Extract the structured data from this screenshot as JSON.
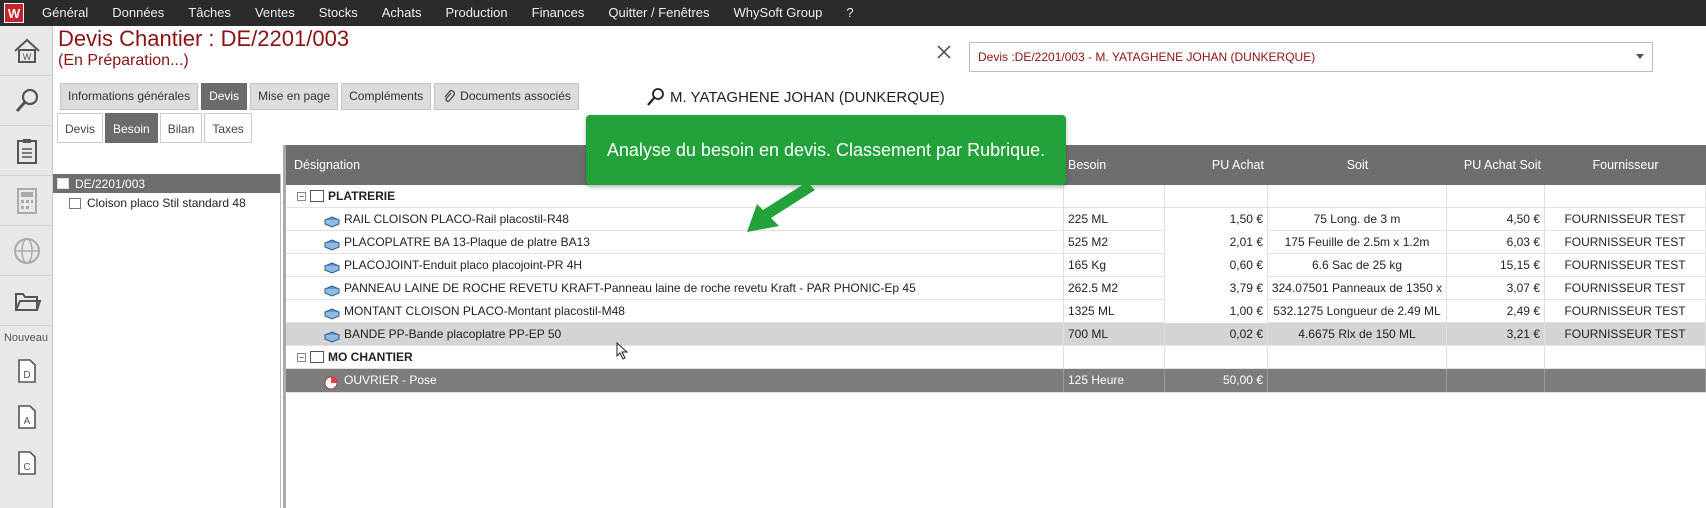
{
  "menubar": {
    "logo": "W",
    "items": [
      "Général",
      "Données",
      "Tâches",
      "Ventes",
      "Stocks",
      "Achats",
      "Production",
      "Finances",
      "Quitter / Fenêtres",
      "WhySoft Group",
      "?"
    ]
  },
  "sidebar": {
    "nouveau_label": "Nouveau",
    "icons": [
      "home-icon",
      "search-icon",
      "clipboard-icon",
      "calculator-icon",
      "globe-icon",
      "folder-open-icon"
    ],
    "new_docs": [
      "D",
      "A",
      "C"
    ]
  },
  "header": {
    "title": "Devis  Chantier : DE/2201/003",
    "subtitle": "(En Préparation...)",
    "selector_value": "Devis :DE/2201/003 - M. YATAGHENE JOHAN   (DUNKERQUE)"
  },
  "tabs": [
    {
      "label": "Informations générales",
      "active": false
    },
    {
      "label": "Devis",
      "active": true
    },
    {
      "label": "Mise en page",
      "active": false
    },
    {
      "label": "Compléments",
      "active": false
    },
    {
      "label": "Documents associés",
      "active": false
    }
  ],
  "client_label": "M. YATAGHENE JOHAN   (DUNKERQUE)",
  "subtabs": [
    {
      "label": "Devis",
      "active": false
    },
    {
      "label": "Besoin",
      "active": true
    },
    {
      "label": "Bilan",
      "active": false
    },
    {
      "label": "Taxes",
      "active": false
    }
  ],
  "tree": {
    "root": "DE/2201/003",
    "child": "Cloison placo Stil standard 48"
  },
  "grid": {
    "columns": [
      "Désignation",
      "Besoin",
      "PU Achat",
      "Soit",
      "PU Achat Soit",
      "Fournisseur"
    ],
    "rubriques": [
      {
        "name": "PLATRERIE",
        "rows": [
          {
            "designation": "RAIL CLOISON PLACO-Rail placostil-R48",
            "besoin": "225 ML",
            "pu_achat": "1,50 €",
            "soit": "75 Long. de 3 m",
            "pu_achat_soit": "4,50 €",
            "fournisseur": "FOURNISSEUR TEST"
          },
          {
            "designation": "PLACOPLATRE BA 13-Plaque de platre BA13",
            "besoin": "525 M2",
            "pu_achat": "2,01 €",
            "soit": "175 Feuille de 2.5m x 1.2m",
            "pu_achat_soit": "6,03 €",
            "fournisseur": "FOURNISSEUR TEST"
          },
          {
            "designation": "PLACOJOINT-Enduit placo placojoint-PR 4H",
            "besoin": "165 Kg",
            "pu_achat": "0,60 €",
            "soit": "6.6 Sac de 25 kg",
            "pu_achat_soit": "15,15 €",
            "fournisseur": "FOURNISSEUR TEST"
          },
          {
            "designation": "PANNEAU LAINE DE ROCHE REVETU KRAFT-Panneau laine de roche revetu Kraft - PAR PHONIC-Ep 45",
            "besoin": "262.5 M2",
            "pu_achat": "3,79 €",
            "soit": "324.07501 Panneaux de 1350 x",
            "pu_achat_soit": "3,07 €",
            "fournisseur": "FOURNISSEUR TEST"
          },
          {
            "designation": "MONTANT CLOISON PLACO-Montant placostil-M48",
            "besoin": "1325 ML",
            "pu_achat": "1,00 €",
            "soit": "532.1275 Longueur de 2.49 ML",
            "pu_achat_soit": "2,49 €",
            "fournisseur": "FOURNISSEUR TEST"
          },
          {
            "designation": "BANDE PP-Bande placoplatre PP-EP 50",
            "besoin": "700 ML",
            "pu_achat": "0,02 €",
            "soit": "4.6675 Rlx de 150 ML",
            "pu_achat_soit": "3,21 €",
            "fournisseur": "FOURNISSEUR TEST"
          }
        ]
      },
      {
        "name": "MO CHANTIER",
        "rows": [
          {
            "designation": "OUVRIER - Pose",
            "besoin": "125 Heure",
            "pu_achat": "50,00 €",
            "soit": "",
            "pu_achat_soit": "",
            "fournisseur": ""
          }
        ]
      }
    ]
  },
  "tooltip": "Analyse du besoin en devis. Classement par Rubrique.",
  "colors": {
    "accent": "#8b1212",
    "tooltip": "#23a13a",
    "active_tab": "#6b6b6b"
  }
}
